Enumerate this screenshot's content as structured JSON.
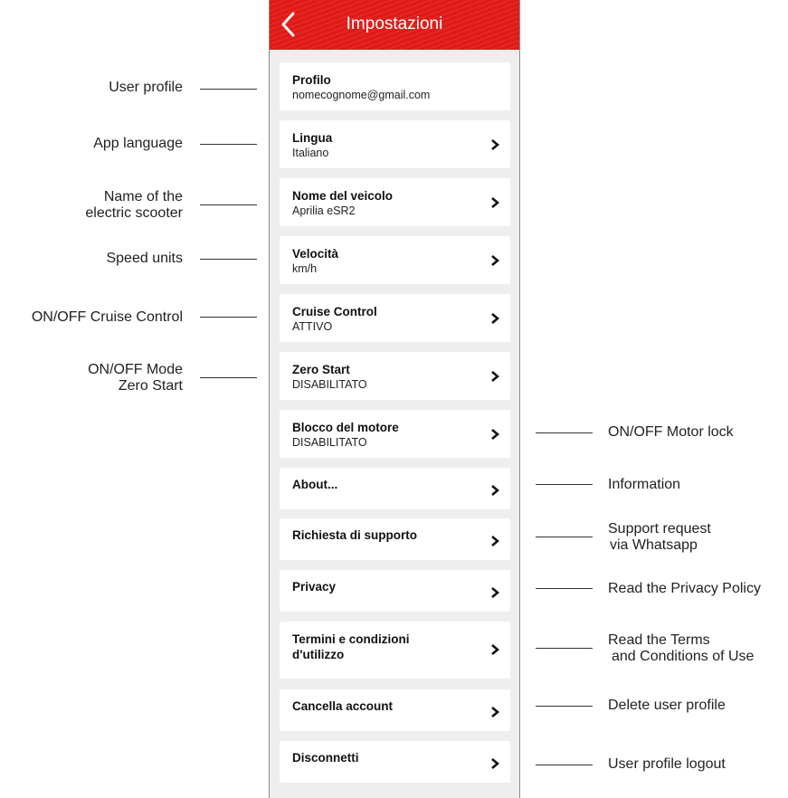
{
  "header": {
    "title": "Impostazioni"
  },
  "settings": [
    {
      "title": "Profilo",
      "subtitle": "nomecognome@gmail.com"
    },
    {
      "title": "Lingua",
      "subtitle": "Italiano"
    },
    {
      "title": "Nome del veicolo",
      "subtitle": "Aprilia eSR2"
    },
    {
      "title": "Velocità",
      "subtitle": "km/h"
    },
    {
      "title": "Cruise Control",
      "subtitle": "ATTIVO"
    },
    {
      "title": "Zero Start",
      "subtitle": "DISABILITATO"
    },
    {
      "title": "Blocco del motore",
      "subtitle": "DISABILITATO"
    },
    {
      "title": "About...",
      "subtitle": ""
    },
    {
      "title": "Richiesta di supporto",
      "subtitle": ""
    },
    {
      "title": "Privacy",
      "subtitle": ""
    },
    {
      "title": "Termini e condizioni",
      "title2": "d'utilizzo",
      "subtitle": ""
    },
    {
      "title": "Cancella account",
      "subtitle": ""
    },
    {
      "title": "Disconnetti",
      "subtitle": ""
    }
  ],
  "annotations_left": [
    {
      "lines": [
        "User profile"
      ]
    },
    {
      "lines": [
        "App language"
      ]
    },
    {
      "lines": [
        "Name of the",
        "electric scooter"
      ]
    },
    {
      "lines": [
        "Speed units"
      ]
    },
    {
      "lines": [
        "ON/OFF Cruise Control"
      ]
    },
    {
      "lines": [
        "ON/OFF Mode",
        "Zero Start"
      ]
    }
  ],
  "annotations_right": [
    {
      "lines": [
        "ON/OFF Motor lock"
      ]
    },
    {
      "lines": [
        "Information"
      ]
    },
    {
      "lines": [
        "Support request",
        "via Whatsapp"
      ]
    },
    {
      "lines": [
        "Read the Privacy Policy"
      ]
    },
    {
      "lines": [
        "Read the Terms",
        "and Conditions of Use"
      ]
    },
    {
      "lines": [
        "Delete user profile"
      ]
    },
    {
      "lines": [
        "User profile logout"
      ]
    }
  ],
  "colors": {
    "header": "#e41b17",
    "background": "#eeeeee",
    "card": "#ffffff"
  }
}
